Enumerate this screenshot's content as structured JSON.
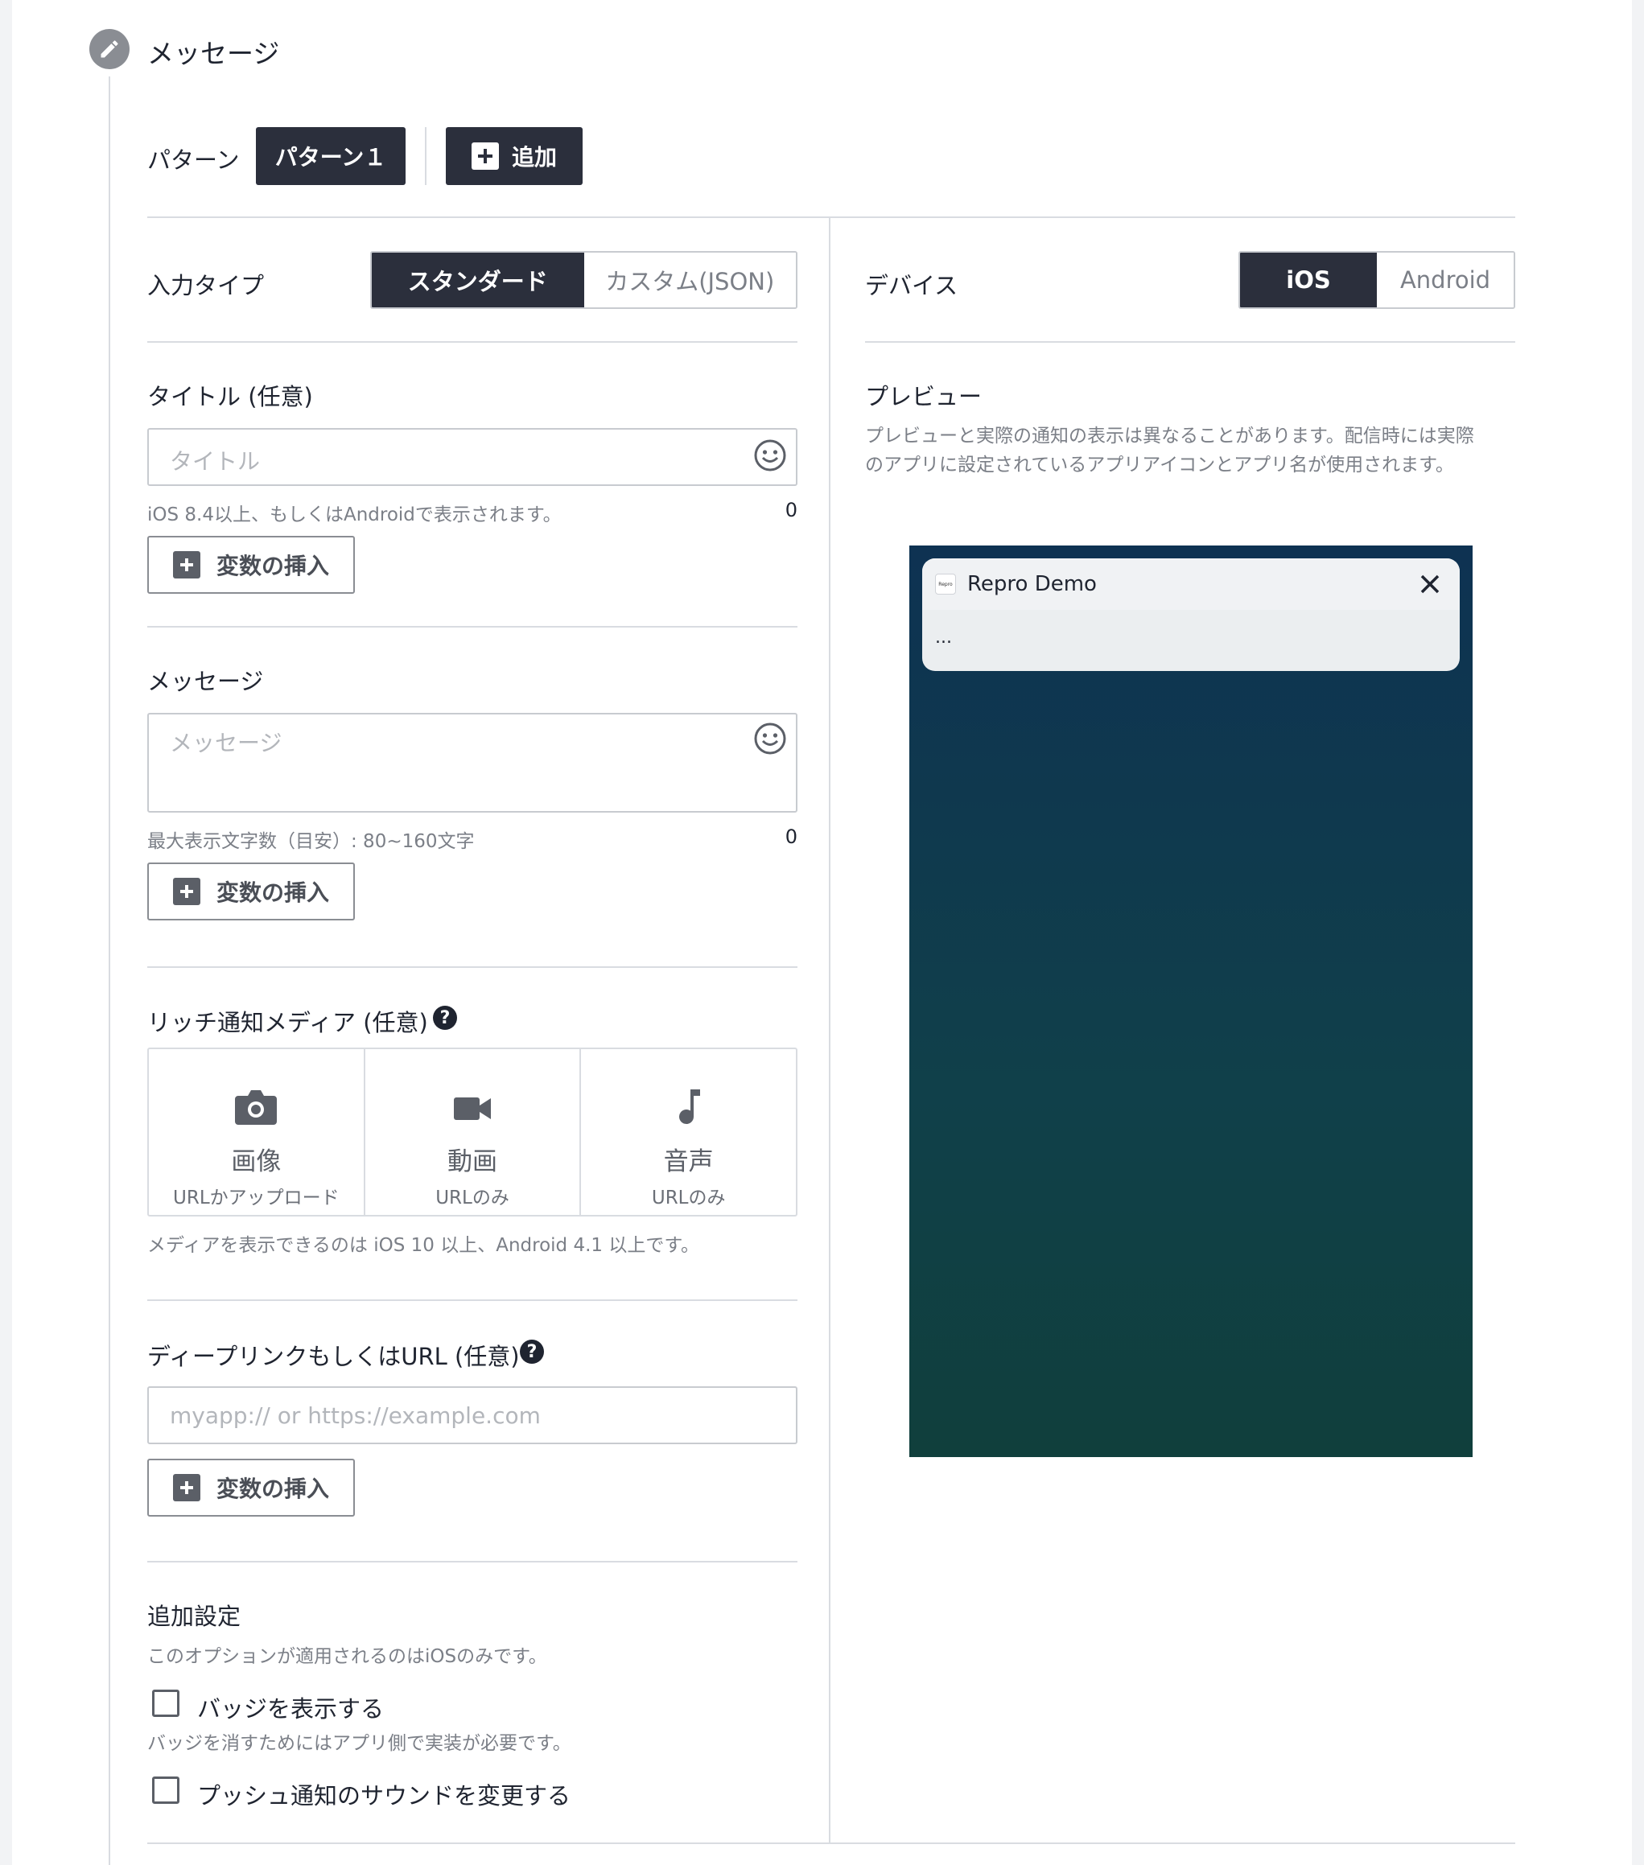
{
  "section": {
    "title": "メッセージ",
    "icon": "pencil-icon"
  },
  "pattern": {
    "label": "パターン",
    "active": "パターン１",
    "add": "追加"
  },
  "input_type": {
    "label": "入力タイプ",
    "options": [
      "スタンダード",
      "カスタム(JSON)"
    ],
    "selected": "スタンダード"
  },
  "device": {
    "label": "デバイス",
    "options": [
      "iOS",
      "Android"
    ],
    "selected": "iOS"
  },
  "title_field": {
    "label": "タイトル (任意)",
    "placeholder": "タイトル",
    "hint": "iOS 8.4以上、もしくはAndroidで表示されます。",
    "count": "0",
    "insert_button": "変数の挿入"
  },
  "message_field": {
    "label": "メッセージ",
    "placeholder": "メッセージ",
    "hint": "最大表示文字数（目安）: 80~160文字",
    "count": "0",
    "insert_button": "変数の挿入"
  },
  "rich_media": {
    "label": "リッチ通知メディア (任意)",
    "items": [
      {
        "name": "画像",
        "sub": "URLかアップロード",
        "icon": "camera-icon"
      },
      {
        "name": "動画",
        "sub": "URLのみ",
        "icon": "video-icon"
      },
      {
        "name": "音声",
        "sub": "URLのみ",
        "icon": "music-note-icon"
      }
    ],
    "hint": "メディアを表示できるのは iOS 10 以上、Android 4.1 以上です。"
  },
  "deeplink": {
    "label": "ディープリンクもしくはURL (任意)",
    "placeholder": "myapp:// or https://example.com",
    "insert_button": "変数の挿入"
  },
  "additional": {
    "label": "追加設定",
    "hint": "このオプションが適用されるのはiOSのみです。",
    "badge_label": "バッジを表示する",
    "badge_hint": "バッジを消すためにはアプリ側で実装が必要です。",
    "sound_label": "プッシュ通知のサウンドを変更する"
  },
  "preview": {
    "label": "プレビュー",
    "description_line1": "プレビューと実際の通知の表示は異なることがあります。配信時には実際",
    "description_line2": "のアプリに設定されているアプリアイコンとアプリ名が使用されます。",
    "app_name": "Repro Demo",
    "app_icon_text": "Repro",
    "body": "..."
  },
  "colors": {
    "dark": "#2b2f3c",
    "border": "#c8cbd0",
    "phone_top": "#0e3252",
    "phone_bottom": "#103f3c"
  }
}
